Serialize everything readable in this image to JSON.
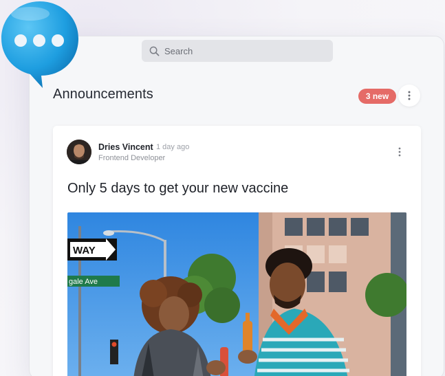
{
  "search": {
    "placeholder": "Search"
  },
  "header": {
    "title": "Announcements",
    "badge": "3 new"
  },
  "post": {
    "author": "Dries Vincent",
    "time": "1 day ago",
    "role": "Frontend Developer",
    "title": "Only 5 days to get your new vaccine"
  },
  "photo_signs": {
    "one_way": "WAY",
    "street": "gale Ave"
  },
  "colors": {
    "badge": "#e56b67",
    "bubble": "#1e9ee0",
    "accent_text": "#262a33"
  }
}
